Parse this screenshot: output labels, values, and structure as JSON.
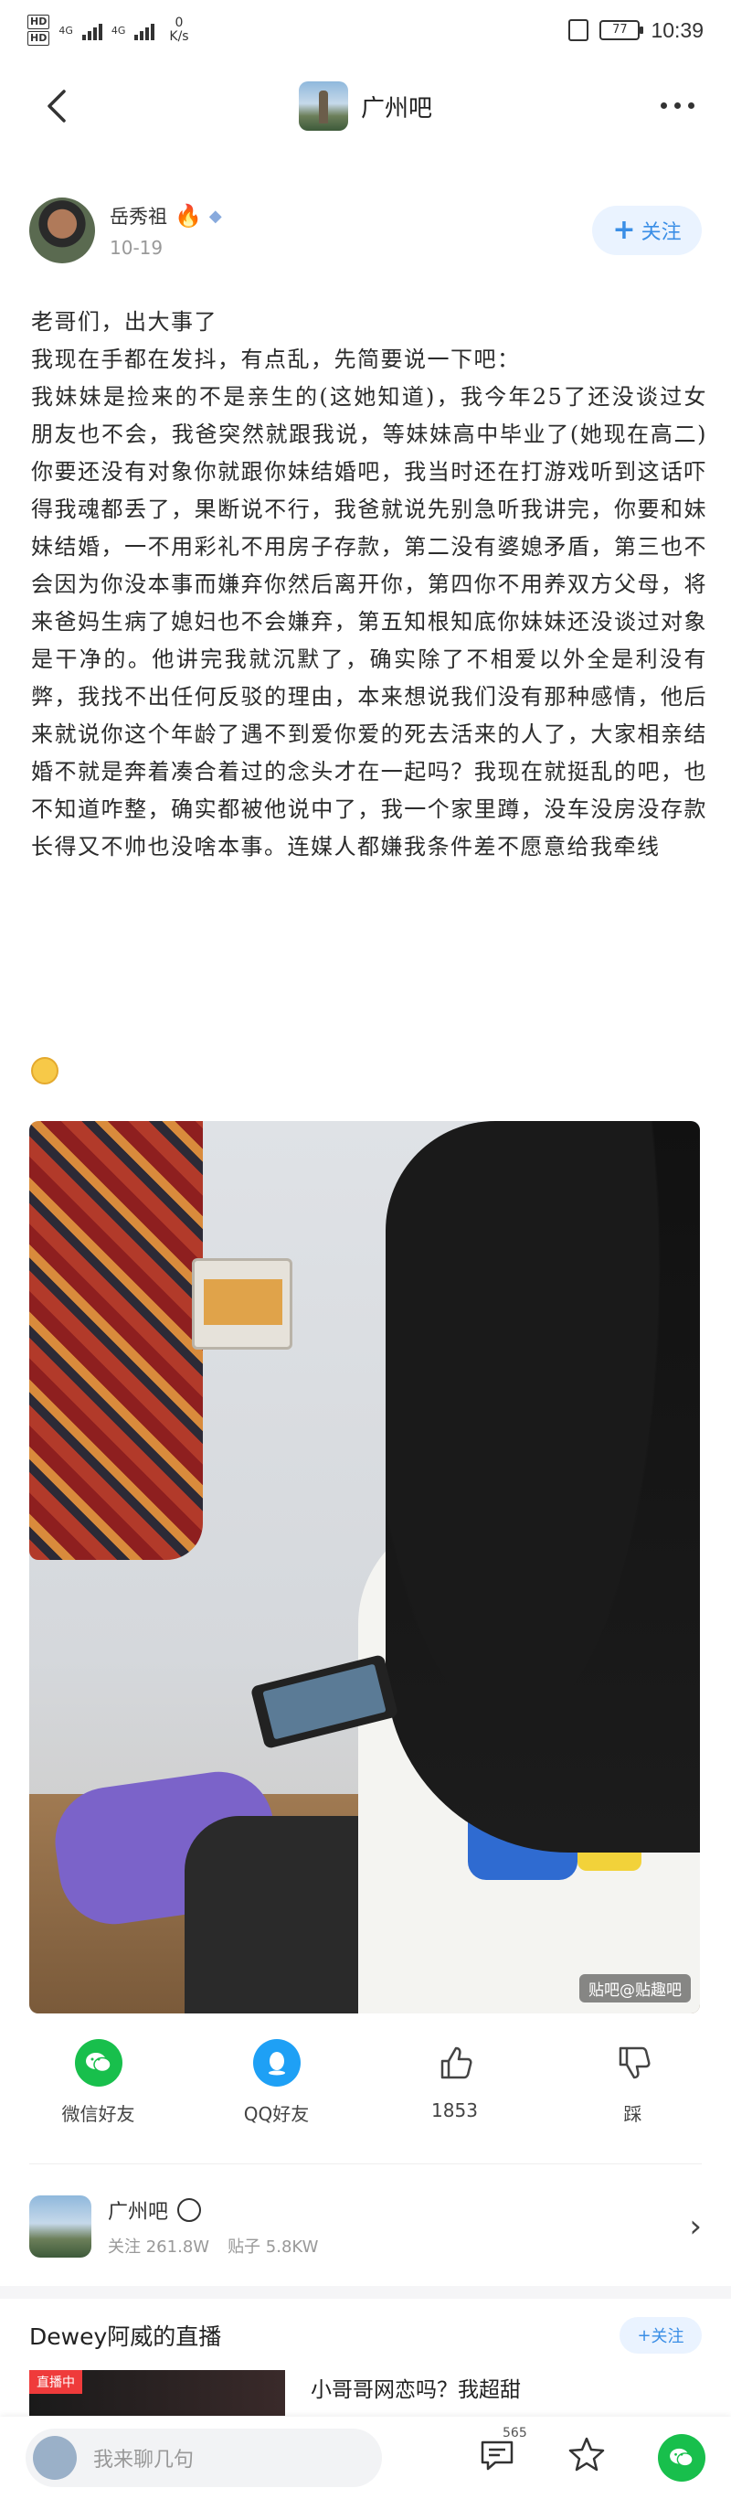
{
  "status_bar": {
    "sim1": "HD",
    "sim2": "HD",
    "net1": "4G",
    "net2": "4G",
    "speed_value": "0",
    "speed_unit": "K/s",
    "battery": "77",
    "time": "10:39"
  },
  "nav": {
    "bar_name": "广州吧"
  },
  "author": {
    "name": "岳秀祖",
    "date": "10-19",
    "follow_label": "关注"
  },
  "post": {
    "text": "老哥们，出大事了\n我现在手都在发抖，有点乱，先简要说一下吧：\n我妹妹是捡来的不是亲生的(这她知道)，我今年25了还没谈过女朋友也不会，我爸突然就跟我说，等妹妹高中毕业了(她现在高二)你要还没有对象你就跟你妹结婚吧，我当时还在打游戏听到这话吓得我魂都丢了，果断说不行，我爸就说先别急听我讲完，你要和妹妹结婚，一不用彩礼不用房子存款，第二没有婆媳矛盾，第三也不会因为你没本事而嫌弃你然后离开你，第四你不用养双方父母，将来爸妈生病了媳妇也不会嫌弃，第五知根知底你妹妹还没谈过对象是干净的。他讲完我就沉默了，确实除了不相爱以外全是利没有弊，我找不出任何反驳的理由，本来想说我们没有那种感情，他后来就说你这个年龄了遇不到爱你爱的死去活来的人了，大家相亲结婚不就是奔着凑合着过的念头才在一起吗？我现在就挺乱的吧，也不知道咋整，确实都被他说中了，我一个家里蹲，没车没房没存款长得又不帅也没啥本事。连媒人都嫌我条件差不愿意给我牵线"
  },
  "image": {
    "watermark": "贴吧@贴趣吧"
  },
  "share": [
    {
      "label": "微信好友",
      "icon": "wechat-icon"
    },
    {
      "label": "QQ好友",
      "icon": "qq-icon"
    },
    {
      "label": "1853",
      "icon": "thumbs-up-icon"
    },
    {
      "label": "踩",
      "icon": "thumbs-down-icon"
    }
  ],
  "forum": {
    "name": "广州吧",
    "follow_label": "关注",
    "follow_value": "261.8W",
    "posts_label": "贴子",
    "posts_value": "5.8KW"
  },
  "live": {
    "title": "Dewey阿威的直播",
    "follow_label": "关注",
    "tag": "直播中",
    "caption": "小哥哥网恋吗？我超甜"
  },
  "bottom": {
    "placeholder": "我来聊几句",
    "comment_count": "565"
  },
  "colors": {
    "accent_blue": "#3a8ee6",
    "wechat_green": "#18bf4c",
    "qq_blue": "#1ea0f5",
    "live_red": "#ef3b3b"
  }
}
